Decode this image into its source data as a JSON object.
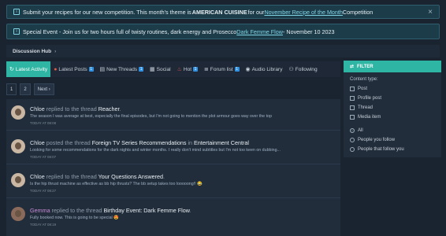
{
  "notices": {
    "first": {
      "pre": "Submit your recipes for our new competition. This month's theme is ",
      "theme": "AMERICAN CUISINE",
      "mid": " for our ",
      "link": "November Recipe of the Month",
      "post": " Competition",
      "close": "×"
    },
    "second": {
      "pre": "Special Event - Join us for two hours full of twisty routines, dark energy and Prosecco ",
      "link": "Dark Femme Flow",
      "post": " - November 10 2023"
    }
  },
  "breadcrumb": {
    "label": "Discussion Hub",
    "sep": "›"
  },
  "tabs": [
    {
      "label": "Latest Activity",
      "icon": "↻",
      "count": ""
    },
    {
      "label": "Latest Posts",
      "icon": "●",
      "count": "1"
    },
    {
      "label": "New Threads",
      "icon": "▤",
      "count": "1"
    },
    {
      "label": "Social",
      "icon": "▦",
      "count": ""
    },
    {
      "label": "Hot",
      "icon": "♨",
      "count": "1"
    },
    {
      "label": "Forum list",
      "icon": "≣",
      "count": "1"
    },
    {
      "label": "Audio Library",
      "icon": "◉",
      "count": ""
    },
    {
      "label": "Following",
      "icon": "⚇",
      "count": ""
    }
  ],
  "pager": {
    "p1": "1",
    "p2": "2",
    "next": "Next ›"
  },
  "activity": [
    {
      "user": "Chloe",
      "action": " replied to the thread ",
      "title": "Reacher",
      "tail": ".",
      "extra": "",
      "preview": "The season I was average at best, especially the final episodes, but I'm not going to mention the plot armour goes way over the top",
      "time": "TODAY AT 08:08"
    },
    {
      "user": "Chloe",
      "action": " posted the thread ",
      "title": "Foreign TV Series Recommendations",
      "tail": " in ",
      "extra": "Entertainment Central",
      "preview": "Looking for some recommendations for the dark nights and winter months. I really don't mind subtitles but I'm not too keen on dubbing...",
      "time": "TODAY AT 08:07"
    },
    {
      "user": "Chloe",
      "action": " replied to the thread ",
      "title": "Your Questions Answered",
      "tail": ".",
      "extra": "",
      "preview": "Is the hip thrust machine as effective as bb hip thrusts? The bb setup takes too looooong!! 😂",
      "time": "TODAY AT 08:27"
    },
    {
      "user": "Gemma",
      "action": " replied to the thread ",
      "title": "Birthday Event: Dark Femme Flow",
      "tail": ".",
      "extra": "",
      "preview": "Fully booked now. This is going to be special 😍",
      "time": "TODAY AT 08:19"
    }
  ],
  "filter": {
    "title": "FILTER",
    "content_type_label": "Content type:",
    "types": [
      "Post",
      "Profile post",
      "Thread",
      "Media item"
    ],
    "scopes": [
      "All",
      "People you follow",
      "People that follow you"
    ],
    "selected_scope": "All"
  },
  "colors": {
    "accent": "#2fb5a3",
    "badge": "#2f8fe0",
    "link": "#7fd4e6"
  }
}
